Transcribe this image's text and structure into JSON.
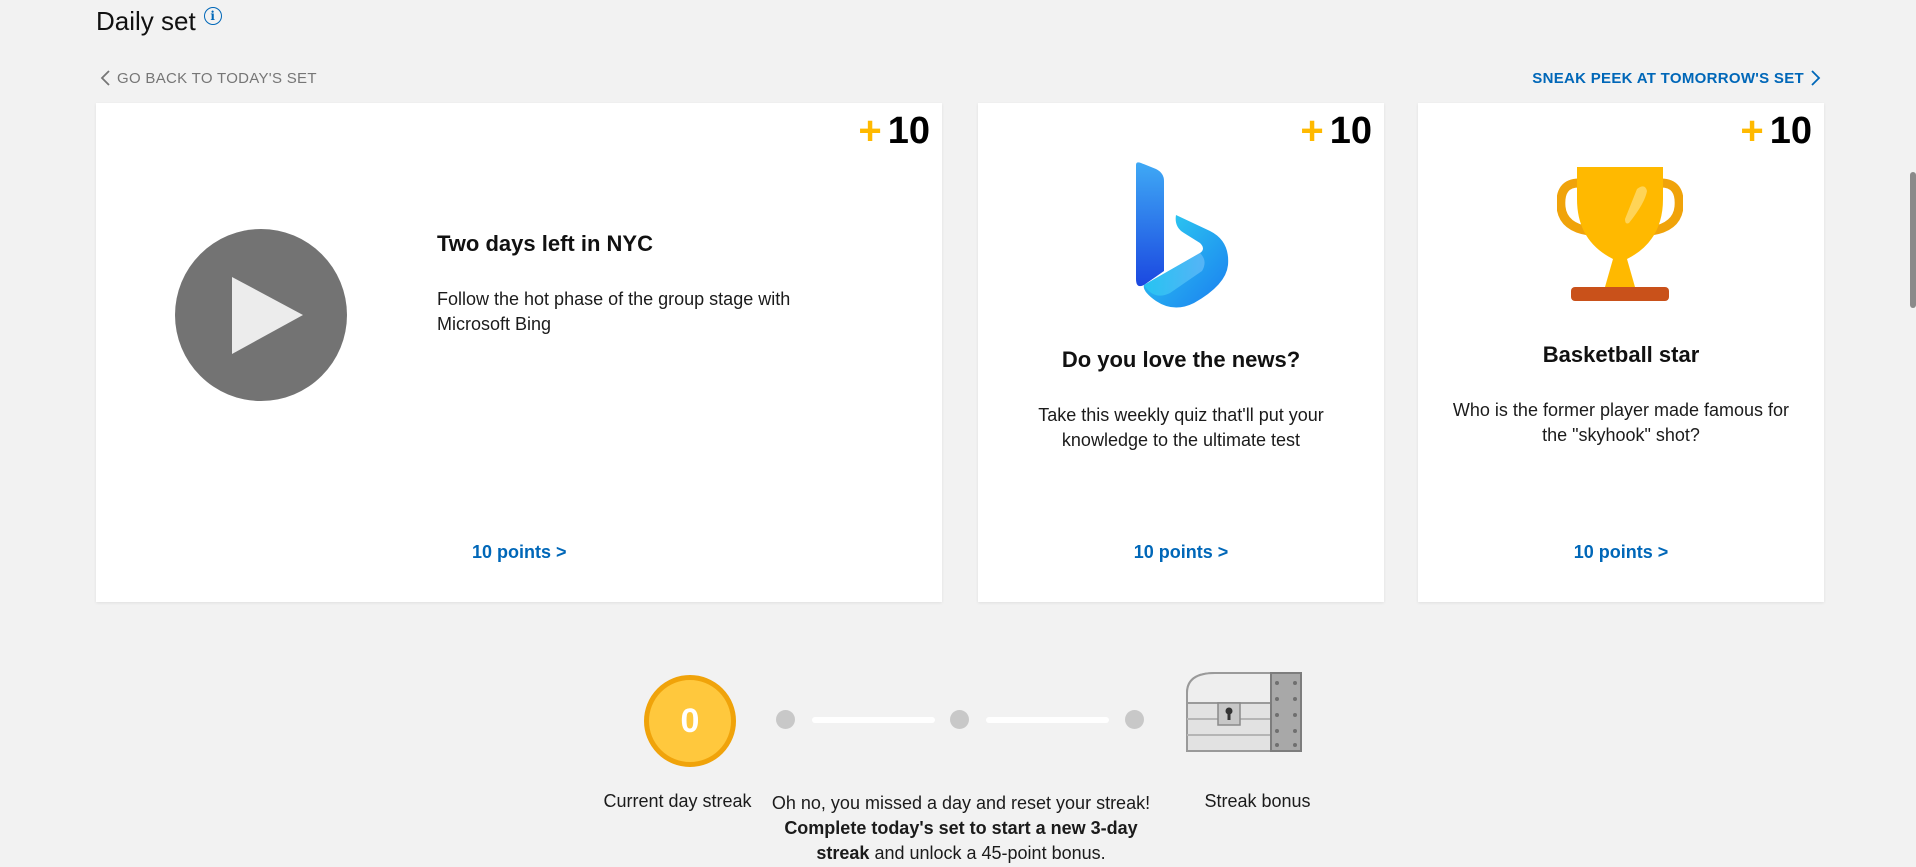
{
  "header": {
    "title": "Daily set",
    "info_icon": "i",
    "back_link": "GO BACK TO TODAY'S SET",
    "forward_link": "SNEAK PEEK AT TOMORROW'S SET"
  },
  "colors": {
    "accent": "#0067b8",
    "points_plus": "#ffb900",
    "coin": "#ffc83d"
  },
  "cards": [
    {
      "points_plus": "+",
      "points": "10",
      "icon": "play-icon",
      "title": "Two days left in NYC",
      "description": "Follow the hot phase of the group stage with Microsoft Bing",
      "link": "10 points >"
    },
    {
      "points_plus": "+",
      "points": "10",
      "icon": "bing-logo-icon",
      "title": "Do you love the news?",
      "description": "Take this weekly quiz that'll put your knowledge to the ultimate test",
      "link": "10 points >"
    },
    {
      "points_plus": "+",
      "points": "10",
      "icon": "trophy-icon",
      "title": "Basketball star",
      "description": "Who is the former player made famous for the \"skyhook\" shot?",
      "link": "10 points >"
    }
  ],
  "streak": {
    "count": "0",
    "current_label": "Current day streak",
    "bonus_label": "Streak bonus",
    "message_plain_1": "Oh no, you missed a day and reset your streak! ",
    "message_bold_1": "Complete today's set to start a new 3-day streak",
    "message_plain_2": " and unlock a 45-point bonus.",
    "chest_icon": "treasure-chest-icon"
  }
}
